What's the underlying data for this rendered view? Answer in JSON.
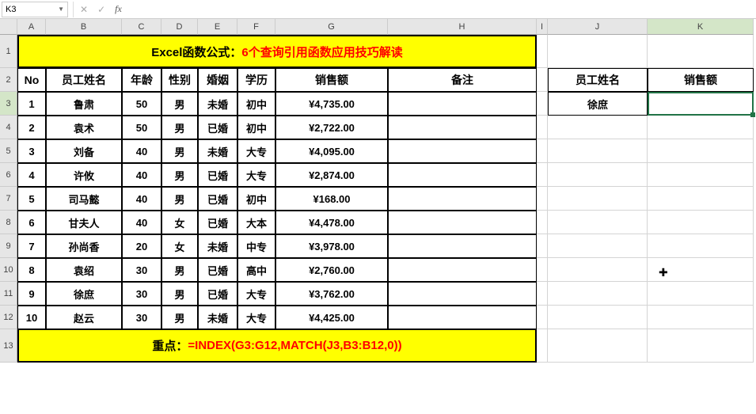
{
  "nameBox": "K3",
  "formula": "",
  "colHeaders": [
    "A",
    "B",
    "C",
    "D",
    "E",
    "F",
    "G",
    "H",
    "I",
    "J",
    "K"
  ],
  "rowHeaders": [
    "1",
    "2",
    "3",
    "4",
    "5",
    "6",
    "7",
    "8",
    "9",
    "10",
    "11",
    "12",
    "13"
  ],
  "activeCol": "K",
  "activeRow": "3",
  "title": {
    "prefix": "Excel函数公式：",
    "main": "6个查询引用函数应用技巧解读"
  },
  "headers": {
    "A": "No",
    "B": "员工姓名",
    "C": "年龄",
    "D": "性别",
    "E": "婚姻",
    "F": "学历",
    "G": "销售额",
    "H": "备注",
    "J": "员工姓名",
    "K": "销售额"
  },
  "lookup": {
    "J": "徐庶",
    "K": ""
  },
  "rows": [
    {
      "no": "1",
      "name": "鲁肃",
      "age": "50",
      "sex": "男",
      "mar": "未婚",
      "edu": "初中",
      "sales": "¥4,735.00"
    },
    {
      "no": "2",
      "name": "袁术",
      "age": "50",
      "sex": "男",
      "mar": "已婚",
      "edu": "初中",
      "sales": "¥2,722.00"
    },
    {
      "no": "3",
      "name": "刘备",
      "age": "40",
      "sex": "男",
      "mar": "未婚",
      "edu": "大专",
      "sales": "¥4,095.00"
    },
    {
      "no": "4",
      "name": "许攸",
      "age": "40",
      "sex": "男",
      "mar": "已婚",
      "edu": "大专",
      "sales": "¥2,874.00"
    },
    {
      "no": "5",
      "name": "司马懿",
      "age": "40",
      "sex": "男",
      "mar": "已婚",
      "edu": "初中",
      "sales": "¥168.00"
    },
    {
      "no": "6",
      "name": "甘夫人",
      "age": "40",
      "sex": "女",
      "mar": "已婚",
      "edu": "大本",
      "sales": "¥4,478.00"
    },
    {
      "no": "7",
      "name": "孙尚香",
      "age": "20",
      "sex": "女",
      "mar": "未婚",
      "edu": "中专",
      "sales": "¥3,978.00"
    },
    {
      "no": "8",
      "name": "袁绍",
      "age": "30",
      "sex": "男",
      "mar": "已婚",
      "edu": "高中",
      "sales": "¥2,760.00"
    },
    {
      "no": "9",
      "name": "徐庶",
      "age": "30",
      "sex": "男",
      "mar": "已婚",
      "edu": "大专",
      "sales": "¥3,762.00"
    },
    {
      "no": "10",
      "name": "赵云",
      "age": "30",
      "sex": "男",
      "mar": "未婚",
      "edu": "大专",
      "sales": "¥4,425.00"
    }
  ],
  "footer": {
    "prefix": "重点：",
    "formula": "=INDEX(G3:G12,MATCH(J3,B3:B12,0))"
  },
  "chart_data": {
    "type": "table",
    "title": "Excel函数公式：6个查询引用函数应用技巧解读",
    "columns": [
      "No",
      "员工姓名",
      "年龄",
      "性别",
      "婚姻",
      "学历",
      "销售额",
      "备注"
    ],
    "data": [
      [
        1,
        "鲁肃",
        50,
        "男",
        "未婚",
        "初中",
        4735.0,
        ""
      ],
      [
        2,
        "袁术",
        50,
        "男",
        "已婚",
        "初中",
        2722.0,
        ""
      ],
      [
        3,
        "刘备",
        40,
        "男",
        "未婚",
        "大专",
        4095.0,
        ""
      ],
      [
        4,
        "许攸",
        40,
        "男",
        "已婚",
        "大专",
        2874.0,
        ""
      ],
      [
        5,
        "司马懿",
        40,
        "男",
        "已婚",
        "初中",
        168.0,
        ""
      ],
      [
        6,
        "甘夫人",
        40,
        "女",
        "已婚",
        "大本",
        4478.0,
        ""
      ],
      [
        7,
        "孙尚香",
        20,
        "女",
        "未婚",
        "中专",
        3978.0,
        ""
      ],
      [
        8,
        "袁绍",
        30,
        "男",
        "已婚",
        "高中",
        2760.0,
        ""
      ],
      [
        9,
        "徐庶",
        30,
        "男",
        "已婚",
        "大专",
        3762.0,
        ""
      ],
      [
        10,
        "赵云",
        30,
        "男",
        "未婚",
        "大专",
        4425.0,
        ""
      ]
    ],
    "lookup": {
      "员工姓名": "徐庶",
      "销售额": null
    },
    "formula": "=INDEX(G3:G12,MATCH(J3,B3:B12,0))"
  }
}
